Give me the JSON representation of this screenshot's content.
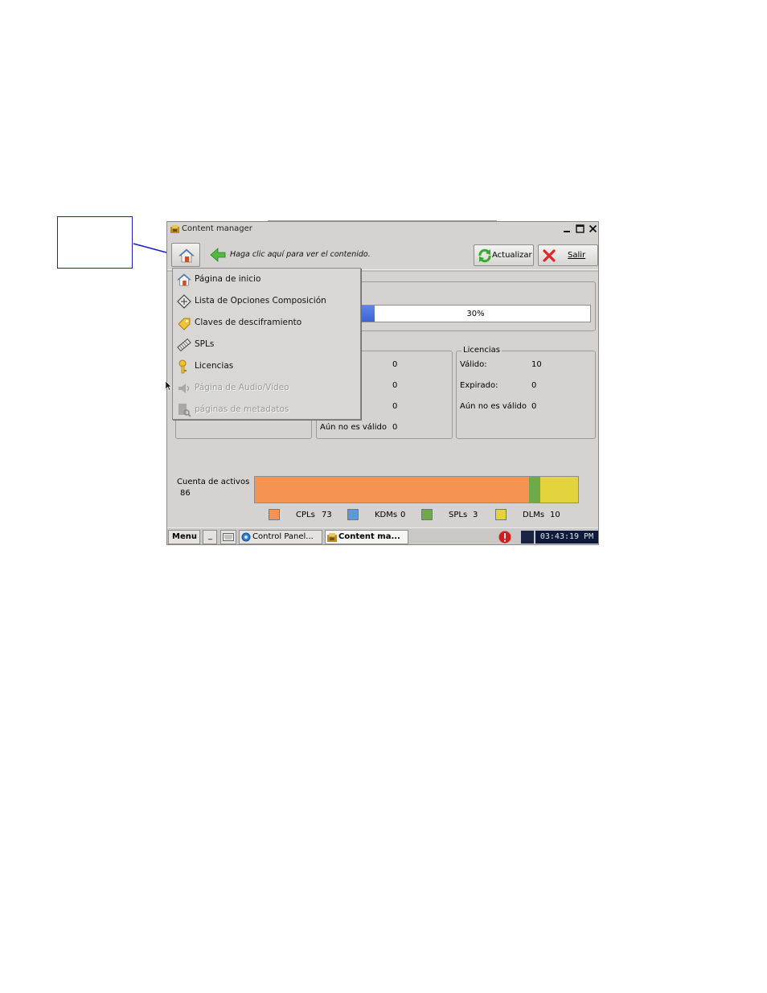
{
  "window": {
    "title": "Content manager",
    "hint": "Haga clic aquí para ver el contenido.",
    "buttons": {
      "refresh": "Actualizar",
      "exit": "Salir"
    }
  },
  "menu": {
    "items": [
      {
        "label": "Página de inicio",
        "icon": "home-icon",
        "enabled": true
      },
      {
        "label": "Lista de Opciones Composición",
        "icon": "composition-list-icon",
        "enabled": true
      },
      {
        "label": "Claves de desciframiento",
        "icon": "key-tag-icon",
        "enabled": true
      },
      {
        "label": "SPLs",
        "icon": "film-strip-icon",
        "enabled": true
      },
      {
        "label": "Licencias",
        "icon": "license-key-icon",
        "enabled": true
      },
      {
        "label": "Página de Audio/Video",
        "icon": "audio-video-icon",
        "enabled": false
      },
      {
        "label": "páginas de metadatos",
        "icon": "metadata-page-icon",
        "enabled": false
      }
    ]
  },
  "progress": {
    "value": 0.3,
    "label": "30%"
  },
  "mid_panel": {
    "values": [
      "0",
      "0",
      "0"
    ],
    "not_valid_label": "Aún no es válido",
    "not_valid_value": "0"
  },
  "licenses": {
    "title": "Licencias",
    "valid_label": "Válido:",
    "valid_value": "10",
    "expired_label": "Expirado:",
    "expired_value": "0",
    "not_valid_label": "Aún no es válido",
    "not_valid_value": "0"
  },
  "assets": {
    "label": "Cuenta de activos",
    "total": "86",
    "legend": [
      {
        "name": "CPLs",
        "value": "73",
        "color": "#f59353"
      },
      {
        "name": "KDMs",
        "value": "0",
        "color": "#5a9ad8"
      },
      {
        "name": "SPLs",
        "value": "3",
        "color": "#6faa4a"
      },
      {
        "name": "DLMs",
        "value": "10",
        "color": "#e3d43e"
      }
    ]
  },
  "taskbar": {
    "menu": "Menu",
    "minimize": "_",
    "control_panel": "Control Panel...",
    "content_manager": "Content ma...",
    "clock": "03:43:19 PM"
  }
}
